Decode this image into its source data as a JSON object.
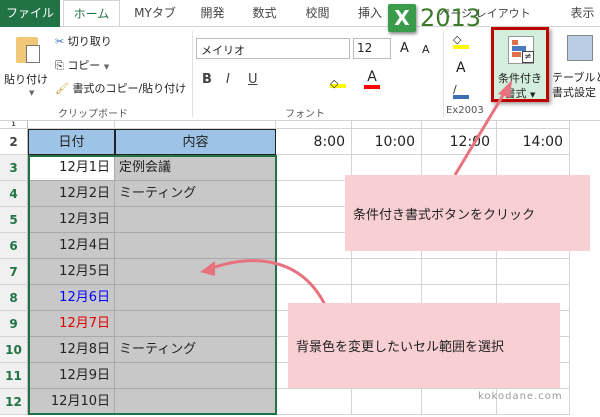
{
  "tabs": [
    "ファイル",
    "ホーム",
    "MYタブ",
    "開発",
    "数式",
    "校閲",
    "挿入",
    "ページ レイアウト",
    "表示"
  ],
  "badge": {
    "logo": "X",
    "version": "2013"
  },
  "clipboard": {
    "paste": "貼り付け",
    "cut": "切り取り",
    "copy": "コピー",
    "format_painter": "書式のコピー/貼り付け",
    "label": "クリップボード"
  },
  "font": {
    "name": "メイリオ",
    "size": "12",
    "bold": "B",
    "italic": "I",
    "underline": "U",
    "label": "フォント",
    "grow": "A",
    "shrink": "A",
    "color_a": "A"
  },
  "ex2003": {
    "label": "Ex2003",
    "a": "A"
  },
  "cond_format": {
    "line1": "条件付き",
    "line2": "書式"
  },
  "table_format": {
    "line1": "テーブルとし",
    "line2": "書式設定"
  },
  "sheet": {
    "header": {
      "row": "2",
      "date": "日付",
      "content": "内容",
      "times": [
        "8:00",
        "10:00",
        "12:00",
        "14:00"
      ]
    },
    "rows": [
      {
        "n": "1",
        "date": "",
        "content": ""
      },
      {
        "n": "3",
        "date": "12月1日",
        "content": "定例会議"
      },
      {
        "n": "4",
        "date": "12月2日",
        "content": "ミーティング"
      },
      {
        "n": "5",
        "date": "12月3日",
        "content": ""
      },
      {
        "n": "6",
        "date": "12月4日",
        "content": ""
      },
      {
        "n": "7",
        "date": "12月5日",
        "content": ""
      },
      {
        "n": "8",
        "date": "12月6日",
        "content": ""
      },
      {
        "n": "9",
        "date": "12月7日",
        "content": ""
      },
      {
        "n": "10",
        "date": "12月8日",
        "content": "ミーティング"
      },
      {
        "n": "11",
        "date": "12月9日",
        "content": ""
      },
      {
        "n": "12",
        "date": "12月10日",
        "content": ""
      }
    ]
  },
  "callouts": {
    "top": "条件付き書式ボタンをクリック",
    "bottom": "背景色を変更したいセル範囲を選択"
  },
  "watermark": "kokodane.com",
  "colors": {
    "accent": "#217346",
    "header_fill": "#9dc3e6",
    "selection": "#c8c8c8",
    "callout": "#f8cfd3",
    "arrow": "#e8737e",
    "blue_date": "#0000ff",
    "red_date": "#e00000"
  }
}
